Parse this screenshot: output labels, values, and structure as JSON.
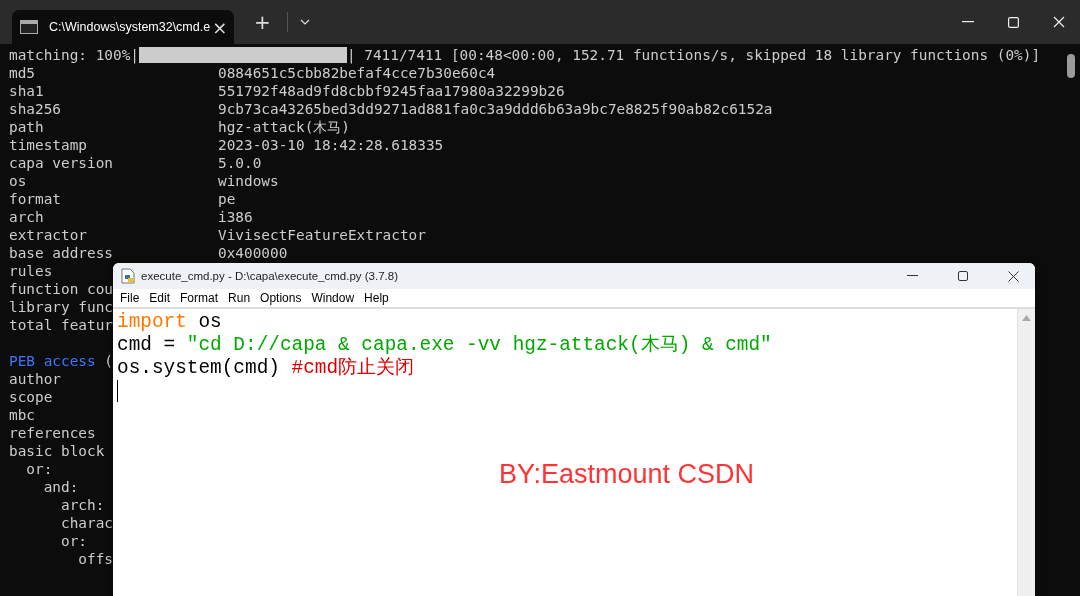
{
  "terminal": {
    "tab": {
      "title": "C:\\Windows\\system32\\cmd.e",
      "close": "×"
    },
    "new_tab": "+",
    "progress": {
      "label": "matching: 100%|",
      "tail": "| 7411/7411 [00:48<00:00, 152.71 functions/s, skipped 18 library functions (0%)]"
    },
    "lines": [
      {
        "key": "md5",
        "value": "0884651c5cbb82befaf4cce7b30e60c4"
      },
      {
        "key": "sha1",
        "value": "551792f48ad9fd8cbbf9245faa17980a32299b26"
      },
      {
        "key": "sha256",
        "value": "9cb73ca43265bed3dd9271ad881fa0c3a9ddd6b63a9bc7e8825f90ab82c6152a"
      },
      {
        "key": "path",
        "value": "hgz-attack(木马)"
      },
      {
        "key": "timestamp",
        "value": "2023-03-10 18:42:28.618335"
      },
      {
        "key": "capa version",
        "value": "5.0.0"
      },
      {
        "key": "os",
        "value": "windows"
      },
      {
        "key": "format",
        "value": "pe"
      },
      {
        "key": "arch",
        "value": "i386"
      },
      {
        "key": "extractor",
        "value": "VivisectFeatureExtractor"
      },
      {
        "key": "base address",
        "value": "0x400000"
      },
      {
        "key": "rules"
      },
      {
        "key": "function cou"
      },
      {
        "key": "library func"
      },
      {
        "key": "total featur"
      },
      {
        "key": "PEB access",
        "kind": "rule",
        "tail": "("
      },
      {
        "key": "author"
      },
      {
        "key": "scope"
      },
      {
        "key": "mbc"
      },
      {
        "key": "references"
      },
      {
        "key": "basic block",
        "children": [
          {
            "key": "or:",
            "children": [
              {
                "key": "and:",
                "children": [
                  {
                    "key": "arch:"
                  },
                  {
                    "key": "charac"
                  },
                  {
                    "key": "or:",
                    "children": [
                      {
                        "key": "offs"
                      }
                    ]
                  }
                ]
              }
            ]
          }
        ]
      }
    ]
  },
  "editor": {
    "title": "execute_cmd.py - D:\\capa\\execute_cmd.py (3.7.8)",
    "menu": [
      "File",
      "Edit",
      "Format",
      "Run",
      "Options",
      "Window",
      "Help"
    ],
    "code": [
      [
        {
          "kind": "keyword",
          "text": "import"
        },
        {
          "kind": "plain",
          "text": " os"
        }
      ],
      [
        {
          "kind": "plain",
          "text": "cmd = "
        },
        {
          "kind": "string",
          "text": "\"cd D://capa & capa.exe -vv hgz-attack(木马) & cmd\""
        }
      ],
      [
        {
          "kind": "plain",
          "text": "os.system(cmd) "
        },
        {
          "kind": "comment",
          "text": "#cmd防止关闭"
        }
      ]
    ],
    "annotation": "BY:Eastmount CSDN"
  }
}
